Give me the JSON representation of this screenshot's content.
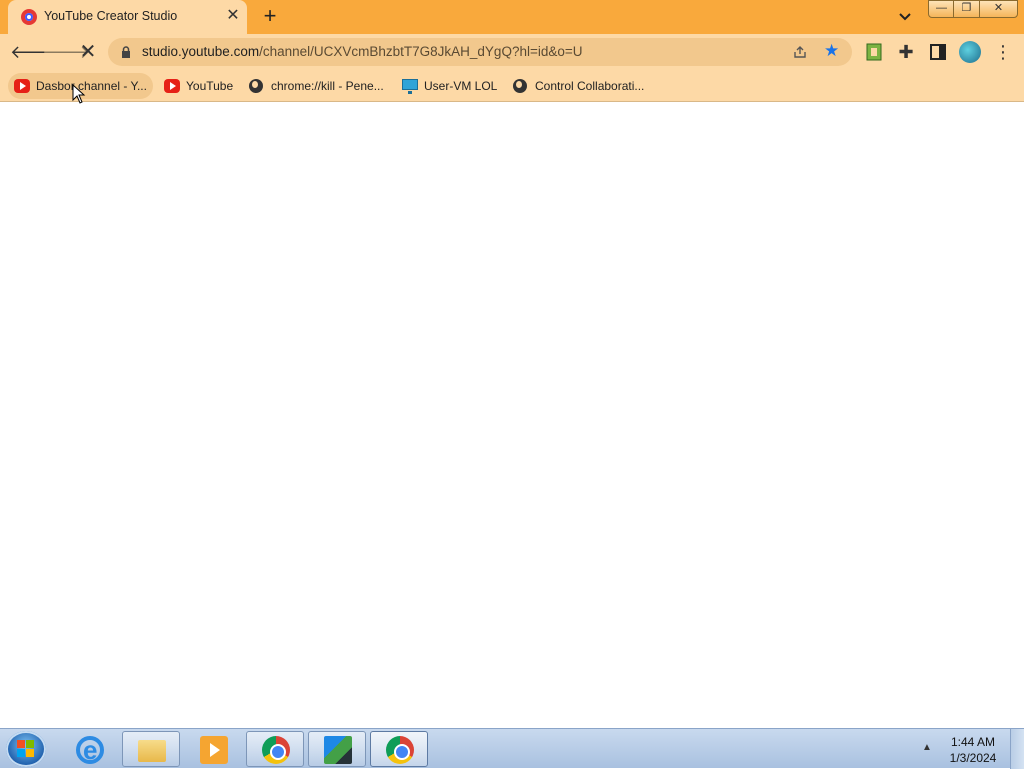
{
  "browser": {
    "tab": {
      "title": "YouTube Creator Studio"
    },
    "address": {
      "host": "studio.youtube.com",
      "path": "/channel/UCXVcmBhzbtT7G8JkAH_dYgQ?hl=id&o=U"
    },
    "bookmarks": [
      {
        "label": "Dasbor channel - Y...",
        "icon": "youtube-icon"
      },
      {
        "label": "YouTube",
        "icon": "youtube-icon"
      },
      {
        "label": "chrome://kill - Pene...",
        "icon": "globe-icon"
      },
      {
        "label": "User-VM LOL",
        "icon": "monitor-icon"
      },
      {
        "label": "Control Collaborati...",
        "icon": "globe-icon"
      }
    ]
  },
  "taskbar": {
    "time": "1:44 AM",
    "date": "1/3/2024",
    "apps": [
      "internet-explorer",
      "file-explorer",
      "media-player",
      "chrome-profile",
      "video-editor",
      "chrome"
    ]
  },
  "colors": {
    "tabstrip": "#f9a93c",
    "toolbar": "#fdd9a6",
    "star": "#1a73e8"
  }
}
